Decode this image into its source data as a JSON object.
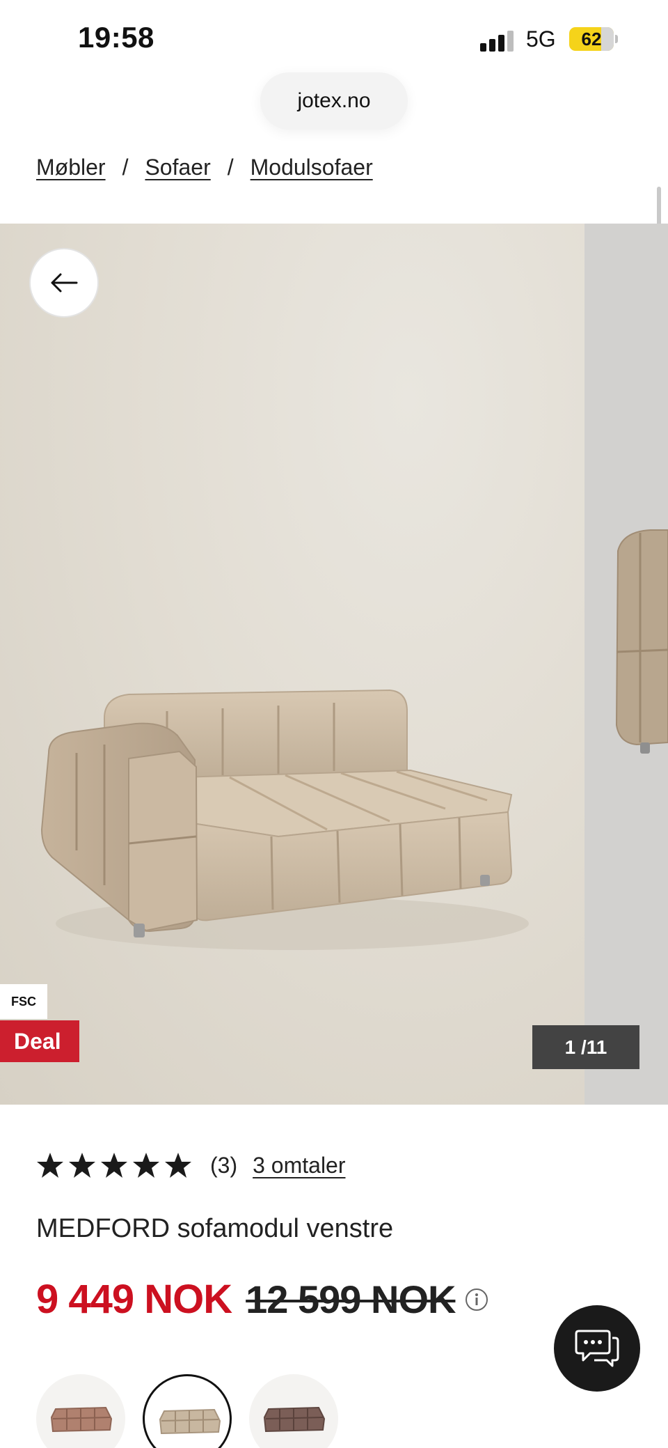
{
  "status_bar": {
    "time": "19:58",
    "network": "5G",
    "battery_percent": "62",
    "battery_level": 0.62
  },
  "browser": {
    "url": "jotex.no"
  },
  "breadcrumb": {
    "items": [
      "Møbler",
      "Sofaer",
      "Modulsofaer"
    ],
    "separator": "/"
  },
  "gallery": {
    "fsc_badge": "FSC",
    "deal_badge": "Deal",
    "counter": "1 /11",
    "back_icon": "arrow-left-icon",
    "colors": {
      "deal": "#cc1f2e",
      "counter_bg": "#434343"
    }
  },
  "product": {
    "rating_stars": 5,
    "rating_count": "(3)",
    "reviews_link": "3 omtaler",
    "title": "MEDFORD sofamodul venstre",
    "price_now": "9 449 NOK",
    "price_old": "12 599 NOK",
    "price_color": "#cc1020"
  },
  "swatches": [
    {
      "name": "rust",
      "color": "#b0816f",
      "selected": false
    },
    {
      "name": "beige",
      "color": "#c8b7a0",
      "selected": true
    },
    {
      "name": "brown",
      "color": "#7b5e57",
      "selected": false
    }
  ]
}
